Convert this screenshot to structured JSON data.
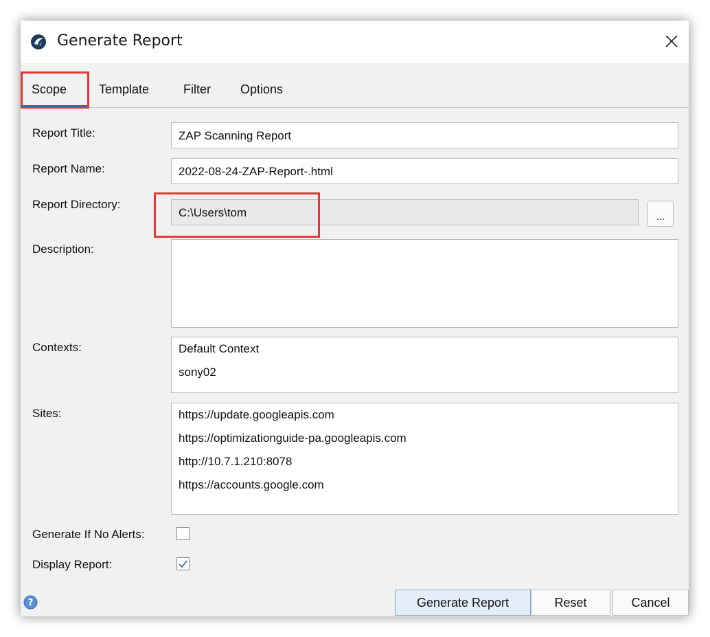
{
  "window": {
    "title": "Generate Report",
    "close_icon": "close-icon",
    "app_icon": "zap-logo-icon"
  },
  "tabs": [
    {
      "label": "Scope",
      "active": true
    },
    {
      "label": "Template"
    },
    {
      "label": "Filter"
    },
    {
      "label": "Options"
    }
  ],
  "form": {
    "report_title": {
      "label": "Report Title:",
      "value": "ZAP Scanning Report"
    },
    "report_name": {
      "label": "Report Name:",
      "value": "2022-08-24-ZAP-Report-.html"
    },
    "report_directory": {
      "label": "Report Directory:",
      "value": "C:\\Users\\tom",
      "browse_label": "..."
    },
    "description": {
      "label": "Description:",
      "value": ""
    },
    "contexts": {
      "label": "Contexts:",
      "items": [
        "Default Context",
        "sony02"
      ]
    },
    "sites": {
      "label": "Sites:",
      "items": [
        "https://update.googleapis.com",
        "https://optimizationguide-pa.googleapis.com",
        "http://10.7.1.210:8078",
        "https://accounts.google.com"
      ]
    },
    "generate_if_no_alerts": {
      "label": "Generate If No Alerts:",
      "checked": false
    },
    "display_report": {
      "label": "Display Report:",
      "checked": true
    }
  },
  "buttons": {
    "generate": "Generate Report",
    "reset": "Reset",
    "cancel": "Cancel"
  },
  "colors": {
    "highlight": "#e53935",
    "tab_underline": "#2f6fa8",
    "checkmark": "#2f6fa8"
  }
}
